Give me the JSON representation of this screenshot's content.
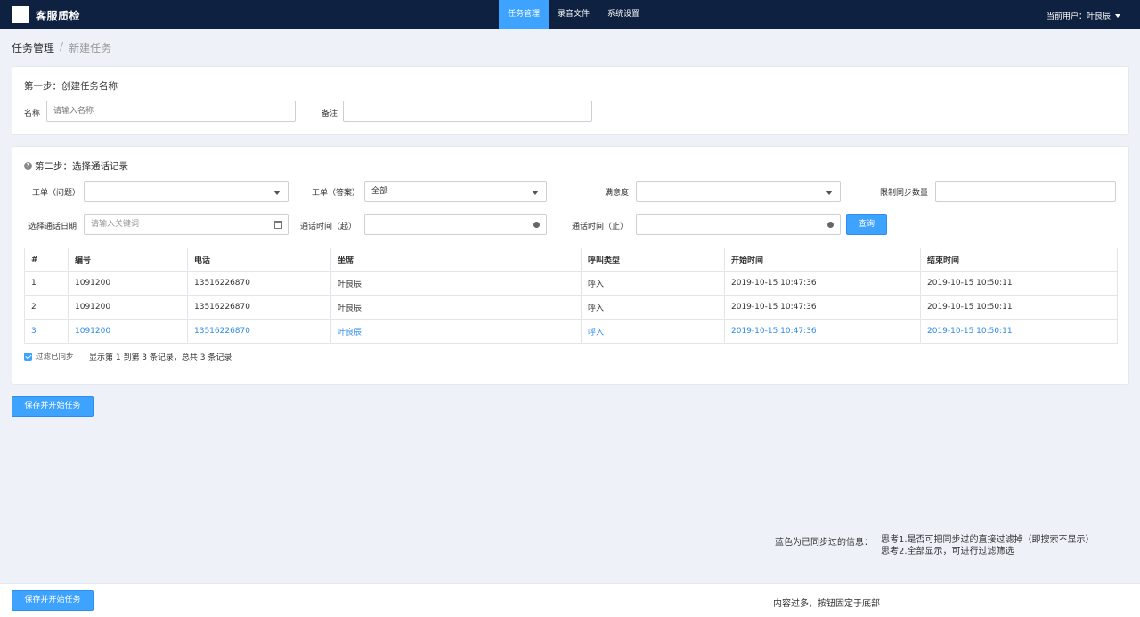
{
  "app": {
    "title": "客服质检"
  },
  "nav": {
    "items": [
      "任务管理",
      "录音文件",
      "系统设置"
    ],
    "active": 0
  },
  "user": {
    "label": "当前用户：叶良辰"
  },
  "breadcrumb": {
    "current": "任务管理",
    "separator": "/",
    "sub": "新建任务"
  },
  "step1": {
    "title": "第一步：创建任务名称",
    "name_label": "名称",
    "name_placeholder": "请输入名称",
    "remark_label": "备注",
    "remark_value": ""
  },
  "step2": {
    "title": "第二步：选择通话记录",
    "filters": {
      "ticket_question_label": "工单（问题）",
      "ticket_question_value": "",
      "ticket_answer_label": "工单（答案）",
      "ticket_answer_value": "全部",
      "satisfaction_label": "满意度",
      "satisfaction_value": "",
      "limit_label": "限制同步数量",
      "limit_value": "",
      "date_label": "选择通话日期",
      "date_placeholder": "请输入关键词",
      "time_start_label": "通话时间（起）",
      "time_start_value": "",
      "time_end_label": "通话时间（止）",
      "time_end_value": "",
      "query_button": "查询"
    },
    "table": {
      "headers": [
        "#",
        "编号",
        "电话",
        "坐席",
        "呼叫类型",
        "开始时间",
        "结束时间"
      ],
      "rows": [
        [
          "1",
          "1091200",
          "13516226870",
          "叶良辰",
          "呼入",
          "2019-10-15 10:47:36",
          "2019-10-15 10:50:11"
        ],
        [
          "2",
          "1091200",
          "13516226870",
          "叶良辰",
          "呼入",
          "2019-10-15 10:47:36",
          "2019-10-15 10:50:11"
        ],
        [
          "3",
          "1091200",
          "13516226870",
          "叶良辰",
          "呼入",
          "2019-10-15 10:47:36",
          "2019-10-15 10:50:11"
        ]
      ],
      "synced_row_index": 2
    },
    "filter_synced_label": "过滤已同步",
    "summary": "显示第 1 到第 3 条记录，总共 3 条记录"
  },
  "save_button": "保存并开始任务",
  "notes": {
    "left": "蓝色为已同步过的信息：",
    "right_line1": "思考1.是否可把同步过的直接过滤掉（即搜索不显示）",
    "right_line2": "思考2.全部显示，可进行过滤筛选"
  },
  "footer": {
    "save_button": "保存并开始任务",
    "note": "内容过多，按钮固定于底部"
  },
  "colors": {
    "topbar": "#0f2140",
    "accent": "#3ea2ff",
    "synced_text": "#2f8be8",
    "background": "#eef1f8"
  }
}
